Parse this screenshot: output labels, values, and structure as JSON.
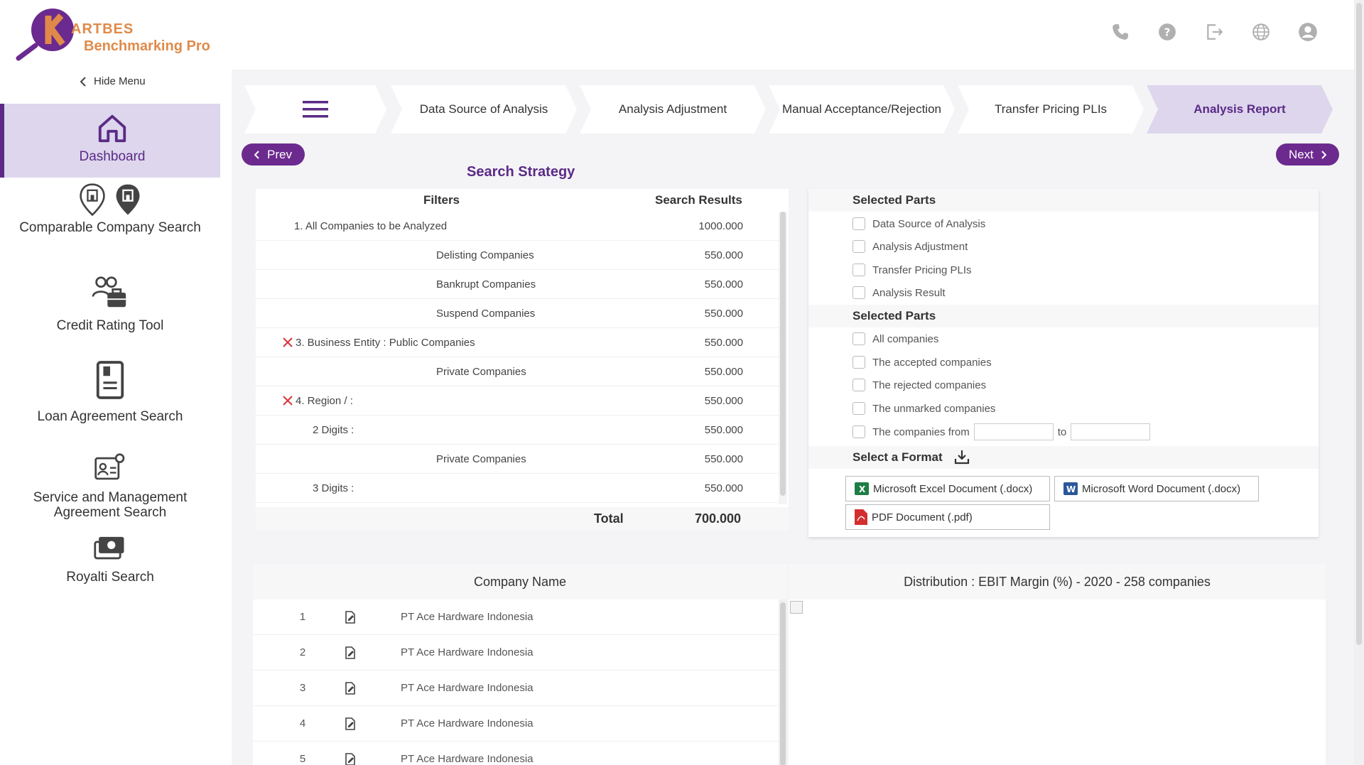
{
  "app": {
    "brand_title": "ARTBES",
    "brand_subtitle": "Benchmarking Pro",
    "hide_menu": "Hide Menu"
  },
  "sidebar": {
    "items": [
      {
        "label": "Dashboard",
        "icon": "home-icon",
        "active": true
      },
      {
        "label": "Comparable Company Search",
        "icon": "location-pin-icon"
      },
      {
        "label": "Credit Rating Tool",
        "icon": "users-briefcase-icon"
      },
      {
        "label": "Loan Agreement Search",
        "icon": "book-icon"
      },
      {
        "label": "Service and Management",
        "label2": "Agreement Search",
        "icon": "settings-card-icon"
      },
      {
        "label": "Royalti Search",
        "icon": "cash-icon"
      }
    ]
  },
  "steps": [
    "Data Source of Analysis",
    "Analysis Adjustment",
    "Manual Acceptance/Rejection",
    "Transfer Pricing PLIs",
    "Analysis Report"
  ],
  "nav": {
    "prev": "Prev",
    "next": "Next"
  },
  "search_strategy": {
    "title": "Search Strategy",
    "col_filters": "Filters",
    "col_results": "Search Results",
    "rows": [
      {
        "filter": "1.   All Companies to be Analyzed",
        "value": "1000.000"
      },
      {
        "filter": "Delisting Companies",
        "value": "550.000"
      },
      {
        "filter": "Bankrupt Companies",
        "value": "550.000"
      },
      {
        "filter": "Suspend Companies",
        "value": "550.000"
      },
      {
        "filter": "3.    Business Entity : Public Companies",
        "value": "550.000"
      },
      {
        "filter": "Private Companies",
        "value": "550.000"
      },
      {
        "filter": "4.    Region / :",
        "value": "550.000"
      },
      {
        "filter": "2 Digits :",
        "value": "550.000"
      },
      {
        "filter": "Private Companies",
        "value": "550.000"
      },
      {
        "filter": "3 Digits :",
        "value": "550.000"
      }
    ],
    "total_label": "Total",
    "total_value": "700.000"
  },
  "selected_parts_1": {
    "title": "Selected Parts",
    "options": [
      "Data Source of Analysis",
      "Analysis Adjustment",
      "Transfer Pricing PLIs",
      "Analysis Result"
    ]
  },
  "selected_parts_2": {
    "title": "Selected Parts",
    "options": [
      "All companies",
      "The accepted companies",
      "The rejected companies",
      "The unmarked companies"
    ],
    "range_label": "The companies from",
    "range_to": "to"
  },
  "format": {
    "title": "Select a Format",
    "excel": "Microsoft Excel Document (.docx)",
    "word": "Microsoft Word Document (.docx)",
    "pdf": "PDF Document (.pdf)"
  },
  "companies": {
    "col_name": "Company Name",
    "rows": [
      {
        "n": "1",
        "name": "PT Ace Hardware Indonesia"
      },
      {
        "n": "2",
        "name": "PT Ace Hardware Indonesia"
      },
      {
        "n": "3",
        "name": "PT Ace Hardware Indonesia"
      },
      {
        "n": "4",
        "name": "PT Ace Hardware Indonesia"
      },
      {
        "n": "5",
        "name": "PT Ace Hardware Indonesia"
      }
    ]
  },
  "distribution": {
    "title": "Distribution : EBIT Margin (%) - 2020 - 258 companies"
  }
}
